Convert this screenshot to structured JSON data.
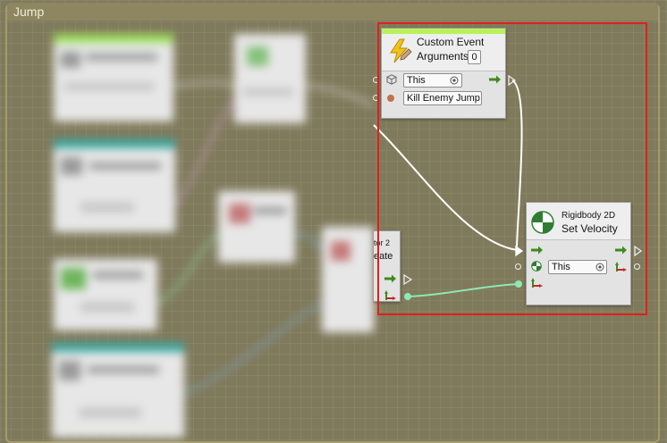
{
  "frame": {
    "title": "Jump"
  },
  "custom_event_node": {
    "title_line1": "Custom Event",
    "title_line2": "Arguments",
    "arguments_count": "0",
    "target_value": "This",
    "event_name_value": "Kill Enemy Jump"
  },
  "set_velocity_node": {
    "subtitle": "Rigidbody 2D",
    "title": "Set Velocity",
    "target_value": "This"
  },
  "partial_node": {
    "line1": "tor 2",
    "line2": "eate"
  },
  "colors": {
    "event_header": "#b7f25c",
    "flow_arrow": "#3f8a1e",
    "data_connection": "#8ee8b3",
    "highlight": "#e0201c",
    "graph_background": "#807a5c"
  }
}
